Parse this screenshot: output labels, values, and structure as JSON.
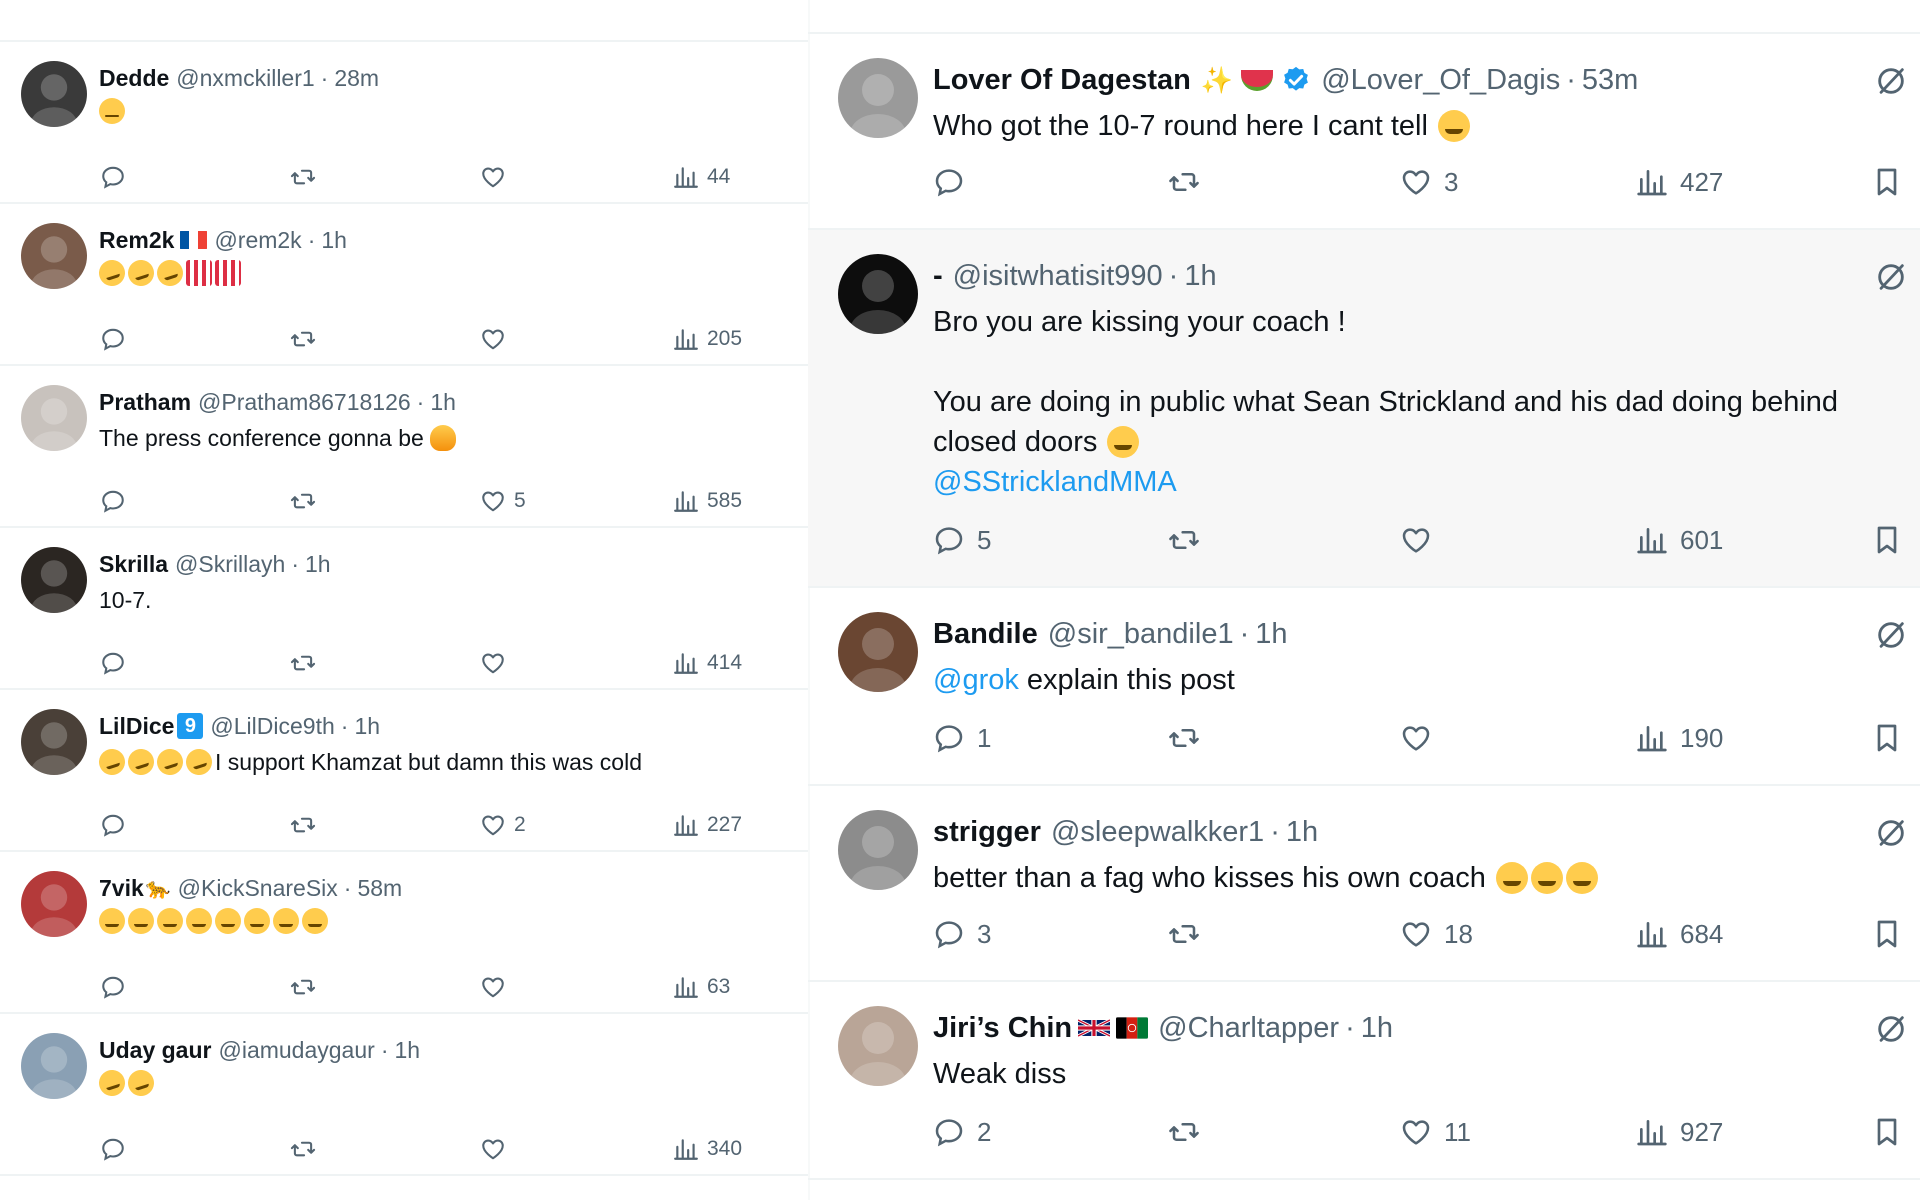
{
  "left_feed": [
    {
      "name": "Dedde",
      "handle": "@nxmckiller1",
      "time": "28m",
      "body": "",
      "emojis": [
        "neutral"
      ],
      "replies": "",
      "likes": "",
      "views": "44",
      "avatar_color": "#3a3a3a"
    },
    {
      "name": "Rem2k",
      "handle": "@rem2k",
      "time": "1h",
      "body": "",
      "emojis": [
        "laugh",
        "laugh",
        "laugh",
        "popcorn",
        "popcorn"
      ],
      "flag": "fr",
      "replies": "",
      "likes": "",
      "views": "205",
      "avatar_color": "#7a5b4a"
    },
    {
      "name": "Pratham",
      "handle": "@Pratham86718126",
      "time": "1h",
      "body": "The press conference gonna be",
      "body_emoji_after": "fire",
      "replies": "",
      "likes": "5",
      "views": "585",
      "avatar_color": "#c8c2bd"
    },
    {
      "name": "Skrilla",
      "handle": "@Skrillayh",
      "time": "1h",
      "body": "10-7.",
      "replies": "",
      "likes": "",
      "views": "414",
      "avatar_color": "#2b2622"
    },
    {
      "name": "LilDice",
      "handle": "@LilDice9th",
      "time": "1h",
      "badge": "9",
      "body": "I support Khamzat but damn this was cold",
      "emojis": [
        "laugh",
        "laugh",
        "laugh",
        "laugh"
      ],
      "replies": "",
      "likes": "2",
      "views": "227",
      "avatar_color": "#4a4038"
    },
    {
      "name": "7vik",
      "handle": "@KickSnareSix",
      "time": "58m",
      "name_suffix": "🐆",
      "body": "",
      "emojis": [
        "joy",
        "joy",
        "joy",
        "joy",
        "joy",
        "joy",
        "joy",
        "joy"
      ],
      "replies": "",
      "likes": "",
      "views": "63",
      "avatar_color": "#b43a3a"
    },
    {
      "name": "Uday gaur",
      "handle": "@iamudaygaur",
      "time": "1h",
      "body": "",
      "emojis": [
        "laugh",
        "laugh"
      ],
      "replies": "",
      "likes": "",
      "views": "340",
      "avatar_color": "#8aa0b4"
    }
  ],
  "right_feed": [
    {
      "name": "Lover Of Dagestan",
      "handle": "@Lover_Of_Dagis",
      "time": "53m",
      "verified": true,
      "body": "Who got the 10-7 round here I cant tell",
      "body_emoji_after": "joy",
      "replies": "",
      "likes": "3",
      "views": "427",
      "avatar_color": "#9a9a9a",
      "highlight": false
    },
    {
      "name": "-",
      "handle": "@isitwhatisit990",
      "time": "1h",
      "lines": [
        "Bro you are kissing your coach !",
        "",
        "You are doing in public what Sean Strickland and his dad doing behind",
        "closed doors"
      ],
      "mention": "@SStricklandMMA",
      "body_emoji_after": "joy",
      "replies": "5",
      "likes": "",
      "views": "601",
      "avatar_color": "#0d0d0d",
      "highlight": true
    },
    {
      "name": "Bandile",
      "handle": "@sir_bandile1",
      "time": "1h",
      "mention": "@grok",
      "body": "explain this post",
      "replies": "1",
      "likes": "",
      "views": "190",
      "avatar_color": "#6a4632",
      "highlight": false
    },
    {
      "name": "strigger",
      "handle": "@sleepwalkker1",
      "time": "1h",
      "body": "better than a fag who kisses his own coach",
      "emojis_after": [
        "joy",
        "joy",
        "joy"
      ],
      "replies": "3",
      "likes": "18",
      "views": "684",
      "avatar_color": "#8c8c8c",
      "highlight": false
    },
    {
      "name": "Jiri’s Chin",
      "handle": "@Charltapper",
      "time": "1h",
      "flags": [
        "uk",
        "af"
      ],
      "body": "Weak diss",
      "replies": "2",
      "likes": "11",
      "views": "927",
      "avatar_color": "#b9a597",
      "highlight": false
    }
  ],
  "icons": {
    "reply": "reply-icon",
    "retweet": "retweet-icon",
    "like": "like-icon",
    "views": "views-icon",
    "bookmark": "bookmark-icon",
    "grok": "grok-icon",
    "verified": "verified-badge-icon"
  },
  "colors": {
    "link": "#1d9bf0",
    "muted": "#536471",
    "text": "#0f1419",
    "verified": "#1d9bf0"
  }
}
